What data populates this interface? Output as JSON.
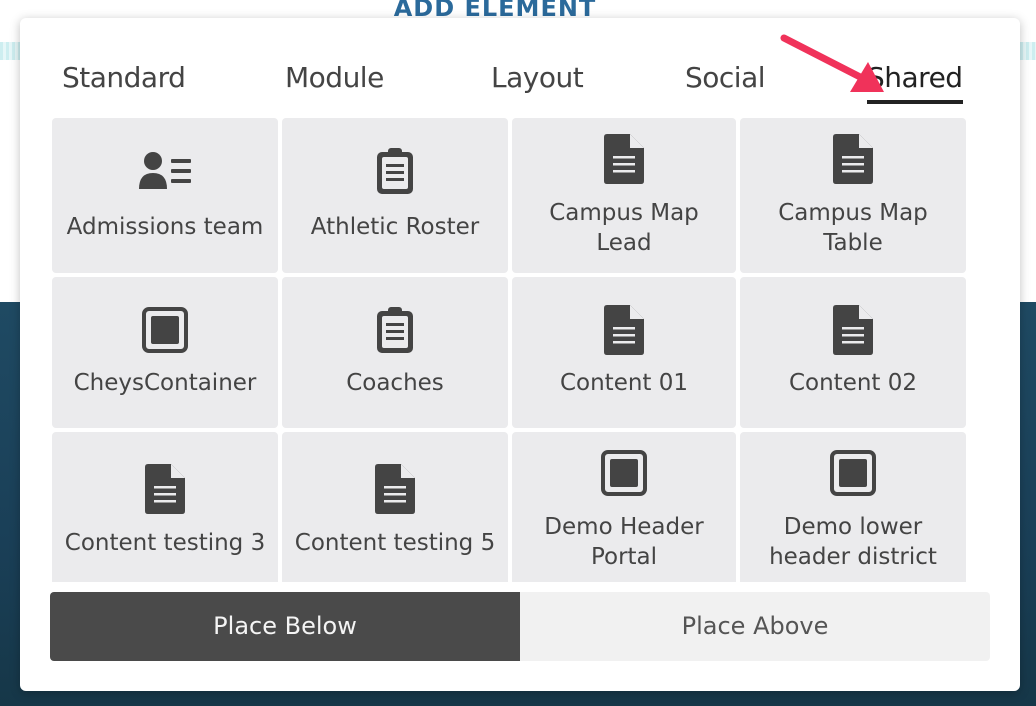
{
  "background": {
    "title": "ADD ELEMENT"
  },
  "tabs": [
    {
      "label": "Standard"
    },
    {
      "label": "Module"
    },
    {
      "label": "Layout"
    },
    {
      "label": "Social"
    },
    {
      "label": "Shared",
      "active": true
    }
  ],
  "items": [
    {
      "label": "Admissions team",
      "icon": "user-list-icon"
    },
    {
      "label": "Athletic Roster",
      "icon": "clipboard-icon"
    },
    {
      "label": "Campus Map Lead",
      "line1": "Campus Map",
      "line2": "Lead",
      "icon": "document-icon"
    },
    {
      "label": "Campus Map Table",
      "line1": "Campus Map",
      "line2": "Table",
      "icon": "document-icon"
    },
    {
      "label": "CheysContainer",
      "icon": "container-icon"
    },
    {
      "label": "Coaches",
      "icon": "clipboard-icon"
    },
    {
      "label": "Content 01",
      "icon": "document-icon"
    },
    {
      "label": "Content 02",
      "icon": "document-icon"
    },
    {
      "label": "Content testing 3",
      "icon": "document-icon"
    },
    {
      "label": "Content testing 5",
      "icon": "document-icon"
    },
    {
      "label": "Demo Header Portal",
      "line1": "Demo Header",
      "line2": "Portal",
      "icon": "container-icon"
    },
    {
      "label": "Demo lower header district",
      "line1": "Demo lower",
      "line2": "header district",
      "icon": "container-icon"
    }
  ],
  "actions": {
    "place_below": "Place Below",
    "place_above": "Place Above"
  },
  "colors": {
    "arrow": "#f0325a",
    "card_bg": "#ebebed",
    "primary_button": "#4a4a4a",
    "icon": "#444444"
  }
}
